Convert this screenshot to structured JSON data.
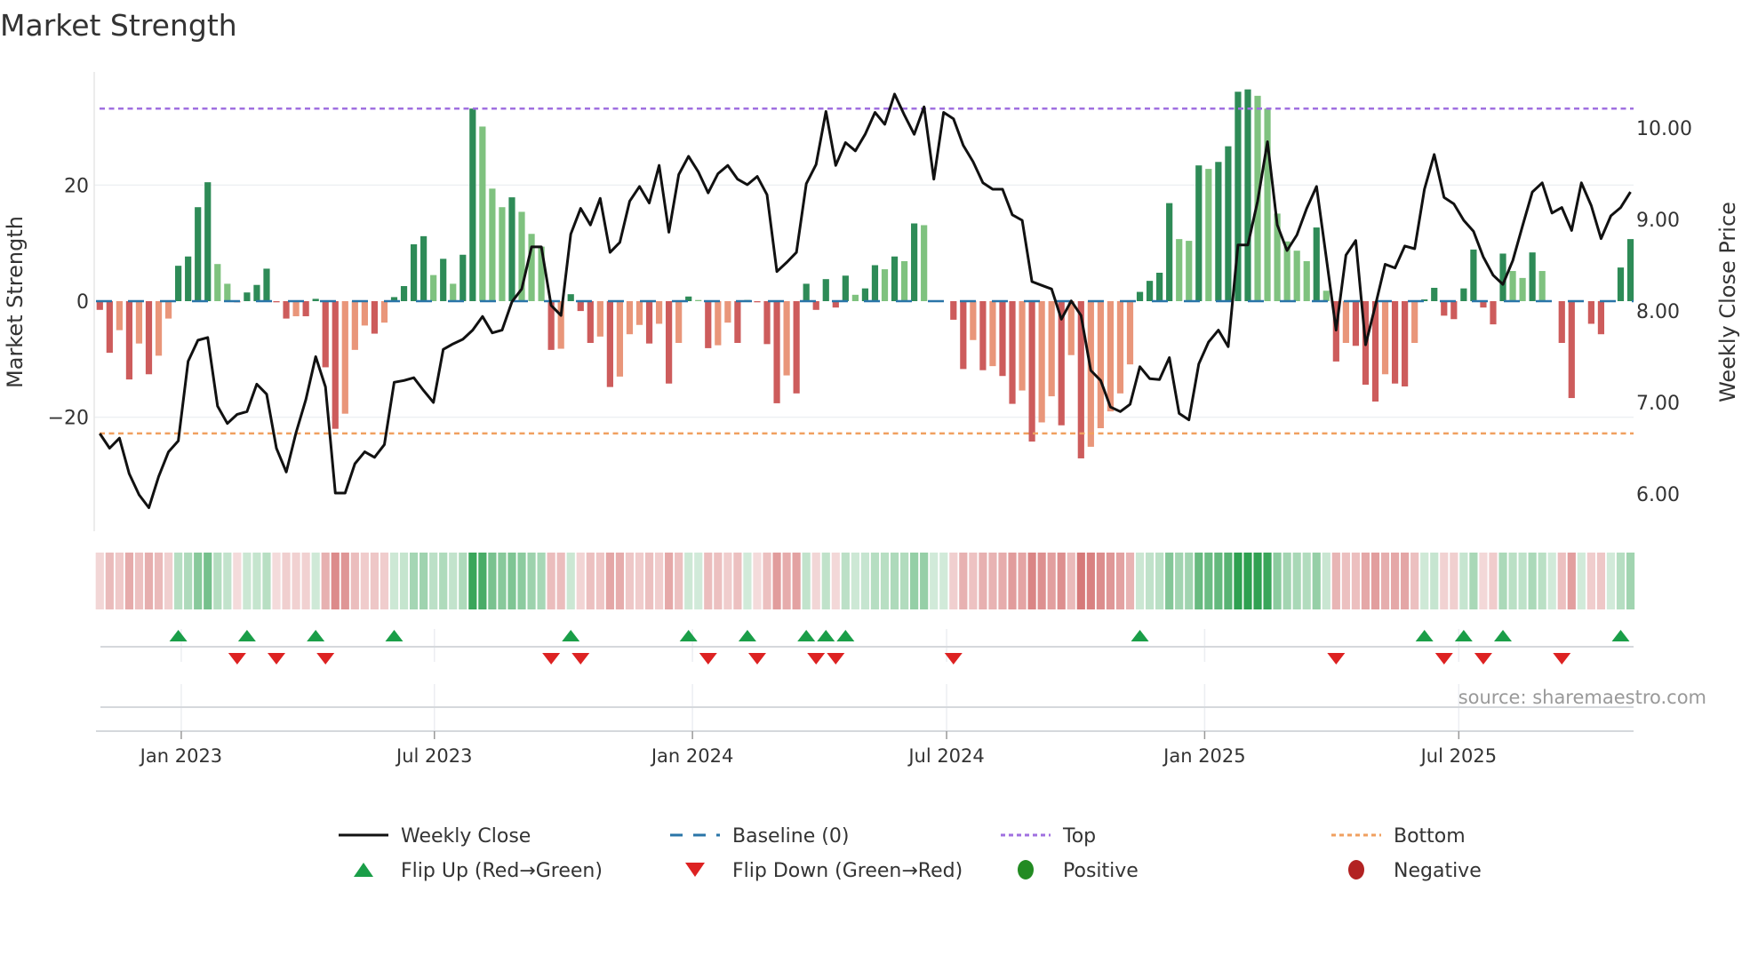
{
  "chart_data": {
    "type": "bar",
    "title": "Market Strength",
    "ylabel": "Market Strength",
    "y2label": "Weekly Close Price",
    "ylim": [
      -39.5,
      39.6
    ],
    "y2lim": [
      5.6,
      10.6
    ],
    "yticks": [
      {
        "v": 20,
        "label": "20"
      },
      {
        "v": 0,
        "label": "0"
      },
      {
        "v": -20,
        "label": "−20"
      }
    ],
    "y2ticks": [
      {
        "v": 10,
        "label": "10.00"
      },
      {
        "v": 9,
        "label": "9.00"
      },
      {
        "v": 8,
        "label": "8.00"
      },
      {
        "v": 7,
        "label": "7.00"
      },
      {
        "v": 6,
        "label": "6.00"
      }
    ],
    "xticks": [
      {
        "week": 8.3,
        "label": "Jan 2023"
      },
      {
        "week": 34.1,
        "label": "Jul 2023"
      },
      {
        "week": 60.4,
        "label": "Jan 2024"
      },
      {
        "week": 86.3,
        "label": "Jul 2024"
      },
      {
        "week": 112.6,
        "label": "Jan 2025"
      },
      {
        "week": 138.5,
        "label": "Jul 2025"
      }
    ],
    "reference_lines": {
      "top": 33.2,
      "bottom": -22.8,
      "baseline": 0
    },
    "strength": [
      -1.5,
      -8.9,
      -5,
      -13.5,
      -7.3,
      -12.6,
      -9.4,
      -3,
      6.1,
      7.7,
      16.2,
      20.5,
      6.4,
      3,
      -0.2,
      1.5,
      2.8,
      5.6,
      -0.2,
      -3,
      -2.6,
      -2.6,
      0.4,
      -11.4,
      -22,
      -19.4,
      -8.4,
      -4.2,
      -5.6,
      -3.7,
      0.7,
      2.6,
      9.8,
      11.2,
      4.5,
      7.3,
      3,
      8,
      33.2,
      30.1,
      19.4,
      16.2,
      17.9,
      15.4,
      11.6,
      9.4,
      -8.4,
      -8.2,
      1.2,
      -1.7,
      -7.2,
      -6.1,
      -14.8,
      -13,
      -5.7,
      -4.1,
      -7.3,
      -3.9,
      -14.2,
      -7.2,
      0.8,
      0.2,
      -8.1,
      -7.6,
      -3.7,
      -7.2,
      0.2,
      -0.2,
      -7.4,
      -17.6,
      -12.8,
      -15.9,
      3,
      -1.5,
      3.8,
      -1.1,
      4.4,
      1.1,
      2.2,
      6.2,
      5.5,
      7.7,
      6.9,
      13.4,
      13.1,
      0,
      0,
      -3.2,
      -11.7,
      -6.7,
      -11.9,
      -11.2,
      -12.9,
      -17.7,
      -15.4,
      -24.2,
      -20.9,
      -16.4,
      -21.4,
      -9.3,
      -27.1,
      -25.1,
      -21.9,
      -19,
      -15.9,
      -10.9,
      1.6,
      3.5,
      4.9,
      16.9,
      10.7,
      10.4,
      23.4,
      22.8,
      24,
      26.7,
      36.1,
      36.5,
      35.4,
      33.2,
      15.1,
      10.3,
      8.7,
      6.9,
      12.7,
      1.8,
      -10.4,
      -7.2,
      -7.7,
      -14.4,
      -17.3,
      -12.6,
      -14.2,
      -14.7,
      -7.2,
      0.3,
      2.3,
      -2.5,
      -3.1,
      2.2,
      8.9,
      -1.1,
      -4,
      8.2,
      5.2,
      4,
      8.4,
      5.2,
      0,
      -7.2,
      -16.7,
      0,
      -3.9,
      -5.7,
      0,
      5.8,
      10.7
    ],
    "weekly_close": [
      6.66,
      6.5,
      6.61,
      6.22,
      5.99,
      5.85,
      6.19,
      6.46,
      6.58,
      7.45,
      7.68,
      7.71,
      6.96,
      6.77,
      6.87,
      6.9,
      7.2,
      7.09,
      6.5,
      6.24,
      6.67,
      7.03,
      7.5,
      7.17,
      6.01,
      6.01,
      6.33,
      6.46,
      6.4,
      6.54,
      7.22,
      7.24,
      7.27,
      7.13,
      7.0,
      7.58,
      7.64,
      7.69,
      7.79,
      7.94,
      7.76,
      7.79,
      8.1,
      8.24,
      8.7,
      8.7,
      8.06,
      7.95,
      8.84,
      9.12,
      8.94,
      9.23,
      8.64,
      8.75,
      9.2,
      9.36,
      9.18,
      9.59,
      8.86,
      9.49,
      9.69,
      9.52,
      9.29,
      9.5,
      9.59,
      9.44,
      9.38,
      9.47,
      9.27,
      8.43,
      8.53,
      8.64,
      9.39,
      9.6,
      10.18,
      9.59,
      9.84,
      9.75,
      9.93,
      10.17,
      10.04,
      10.37,
      10.14,
      9.93,
      10.23,
      9.44,
      10.17,
      10.1,
      9.81,
      9.63,
      9.4,
      9.33,
      9.33,
      9.05,
      8.99,
      8.32,
      8.28,
      8.24,
      7.91,
      8.11,
      7.95,
      7.35,
      7.24,
      6.95,
      6.9,
      6.98,
      7.39,
      7.26,
      7.25,
      7.49,
      6.88,
      6.81,
      7.42,
      7.66,
      7.79,
      7.61,
      8.72,
      8.72,
      9.2,
      9.85,
      8.94,
      8.66,
      8.83,
      9.12,
      9.36,
      8.58,
      7.79,
      8.61,
      8.77,
      7.63,
      8.06,
      8.51,
      8.47,
      8.71,
      8.68,
      9.33,
      9.71,
      9.24,
      9.17,
      8.99,
      8.87,
      8.59,
      8.39,
      8.29,
      8.55,
      8.93,
      9.3,
      9.4,
      9.07,
      9.13,
      8.88,
      9.4,
      9.15,
      8.79,
      9.04,
      9.13,
      9.3
    ],
    "flip_up_weeks": [
      8,
      15,
      22,
      30,
      48,
      60,
      66,
      72,
      74,
      76,
      106,
      135,
      139,
      143,
      155
    ],
    "flip_down_weeks": [
      14,
      18,
      23,
      46,
      49,
      62,
      67,
      73,
      75,
      87,
      126,
      137,
      141,
      149
    ],
    "legend": [
      {
        "label": "Weekly Close",
        "kind": "line-solid",
        "color": "#111111"
      },
      {
        "label": "Baseline (0)",
        "kind": "line-dashed",
        "color": "#2a75a8"
      },
      {
        "label": "Top",
        "kind": "line-dotted",
        "color": "#a070e0"
      },
      {
        "label": "Bottom",
        "kind": "line-dotted",
        "color": "#f0a060"
      },
      {
        "label": "Flip Up (Red→Green)",
        "kind": "triangle-up",
        "color": "#1a9e48"
      },
      {
        "label": "Flip Down (Green→Red)",
        "kind": "triangle-down",
        "color": "#dd2222"
      },
      {
        "label": "Positive",
        "kind": "circle",
        "color": "#228b22"
      },
      {
        "label": "Negative",
        "kind": "circle",
        "color": "#b22222"
      }
    ],
    "legend_position": "bottom",
    "colors": {
      "pos_rising": "#2e8b57",
      "pos_falling": "#7fc27f",
      "neg_falling": "#cd5c5c",
      "neg_rising": "#e9967a"
    }
  },
  "source": "source: sharemaestro.com"
}
